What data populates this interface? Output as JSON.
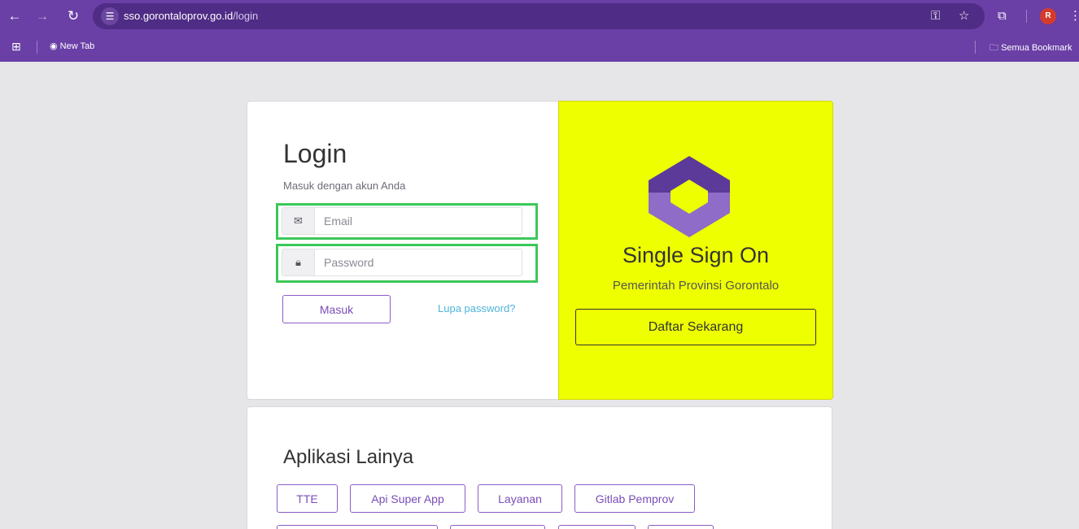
{
  "browser": {
    "url_host": "sso.gorontaloprov.go.id",
    "url_path": "/login",
    "avatar_initial": "R",
    "bookmark_newtab": "New Tab",
    "bookmark_all": "Semua Bookmark"
  },
  "login": {
    "title": "Login",
    "subtitle": "Masuk dengan akun Anda",
    "email_placeholder": "Email",
    "password_placeholder": "Password",
    "submit_label": "Masuk",
    "forgot_label": "Lupa password?"
  },
  "sso": {
    "title": "Single Sign On",
    "subtitle": "Pemerintah Provinsi Gorontalo",
    "register_label": "Daftar Sekarang",
    "accent_color": "#eeff00"
  },
  "apps": {
    "title": "Aplikasi Lainya",
    "items": [
      {
        "label": "TTE"
      },
      {
        "label": "Api Super App"
      },
      {
        "label": "Layanan"
      },
      {
        "label": "Gitlab Pemprov"
      }
    ]
  },
  "colors": {
    "brand_purple": "#6a3fa6",
    "button_purple": "#7a4db8",
    "link_blue": "#4fb3d9",
    "highlight_green": "#3cc85a"
  }
}
